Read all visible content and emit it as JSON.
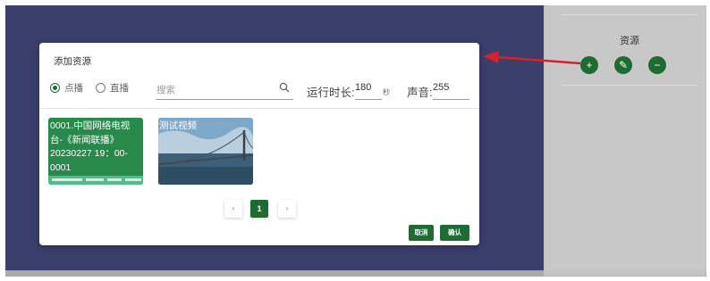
{
  "colors": {
    "primary": "#1e6b34",
    "overlay": "#3a3f6b",
    "arrow": "#d9202a"
  },
  "right_panel": {
    "title": "资源",
    "buttons": [
      {
        "icon": "plus-icon",
        "glyph": "+"
      },
      {
        "icon": "pencil-icon",
        "glyph": "✎"
      },
      {
        "icon": "minus-icon",
        "glyph": "−"
      }
    ]
  },
  "modal": {
    "title": "添加资源",
    "radio_vod": "点播",
    "radio_live": "直播",
    "selected": "点播",
    "search_placeholder": "搜索",
    "duration_label": "运行时长:",
    "duration_value": "180",
    "duration_unit": "秒",
    "volume_label": "声音:",
    "volume_value": "255",
    "cards": [
      {
        "title": "0001.中国网络电视台-《新闻联播》20230227 19：00-0001",
        "lines": [
          "0001.中国网络电视",
          "台-《新闻联播》",
          "20230227 19：00-",
          "0001"
        ]
      },
      {
        "title": "测试视频"
      }
    ],
    "pagination": {
      "prev": "‹",
      "current": "1",
      "next": "›"
    },
    "cancel_label": "取消",
    "confirm_label": "确认"
  }
}
